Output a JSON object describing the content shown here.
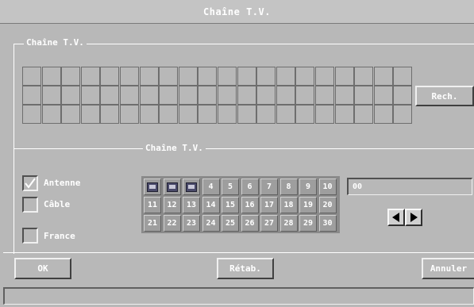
{
  "window": {
    "title": "Chaîne T.V."
  },
  "top_group": {
    "label": "Chaîne T.V.",
    "search_button": "Rech."
  },
  "bottom_group": {
    "label": "Chaîne T.V."
  },
  "options": [
    {
      "label": "Antenne",
      "checked": true
    },
    {
      "label": "Câble",
      "checked": false
    },
    {
      "label": "France",
      "checked": false
    }
  ],
  "channel_grid": {
    "rows": [
      [
        "tv",
        "tv",
        "tv",
        "4",
        "5",
        "6",
        "7",
        "8",
        "9",
        "10"
      ],
      [
        "11",
        "12",
        "13",
        "14",
        "15",
        "16",
        "17",
        "18",
        "19",
        "20"
      ],
      [
        "21",
        "22",
        "23",
        "24",
        "25",
        "26",
        "27",
        "28",
        "29",
        "30"
      ]
    ]
  },
  "channel_field": {
    "value": "00"
  },
  "nav": {
    "prev_icon": "left-triangle-icon",
    "next_icon": "right-triangle-icon"
  },
  "buttons": {
    "ok": "OK",
    "reset": "Rétab.",
    "cancel": "Annuler"
  }
}
